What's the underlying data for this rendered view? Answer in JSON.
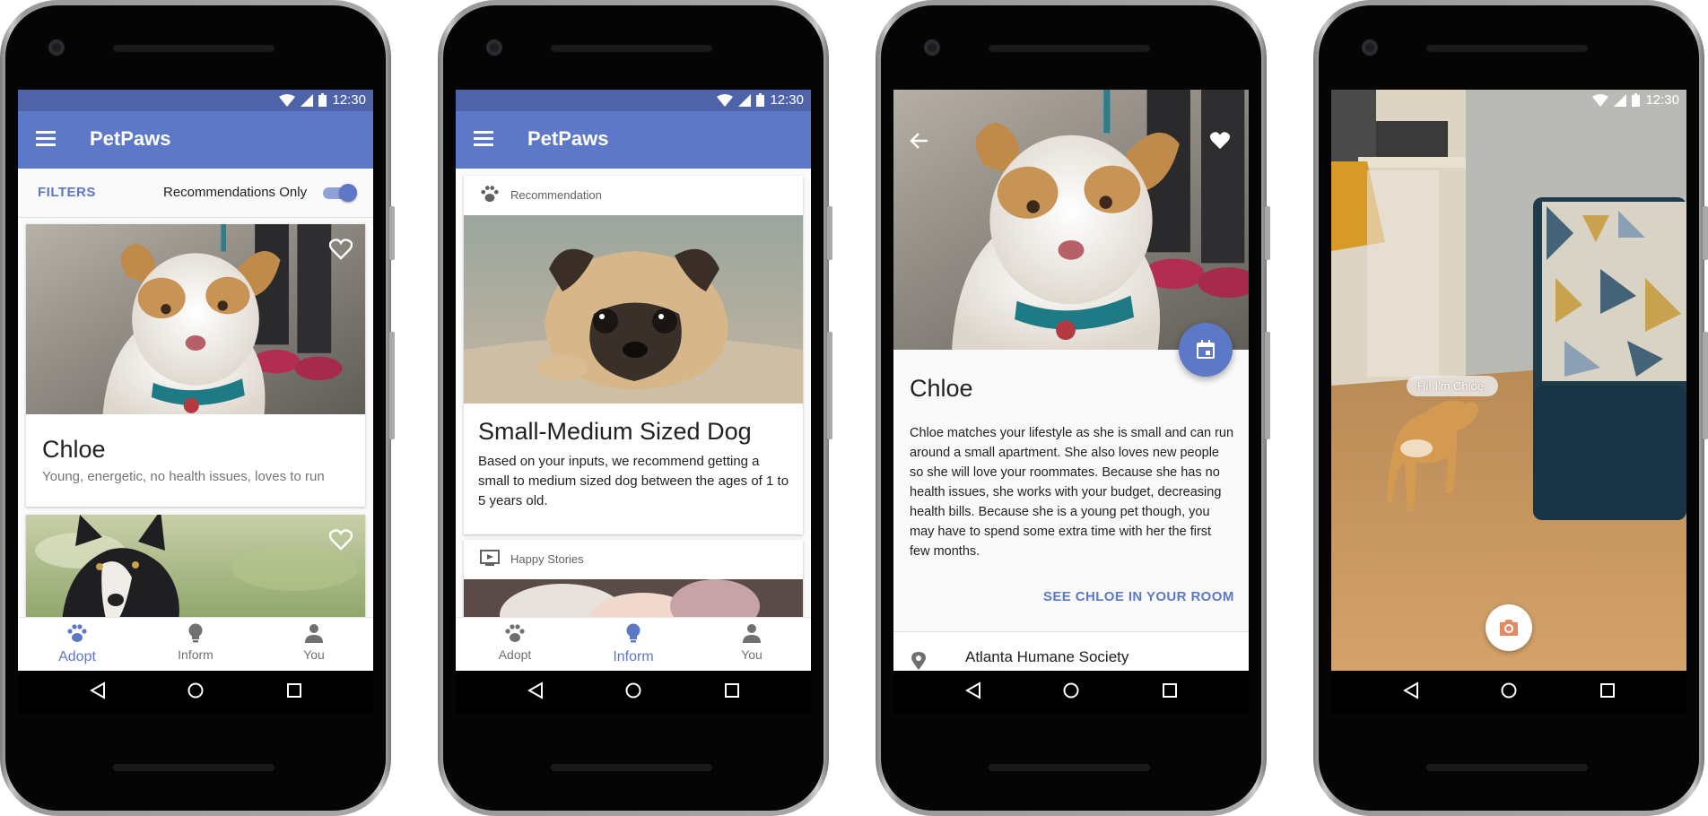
{
  "status": {
    "time": "12:30"
  },
  "app": {
    "title": "PetPaws"
  },
  "screen1": {
    "filters_label": "FILTERS",
    "recommendations_label": "Recommendations Only",
    "recommendations_on": true,
    "cards": [
      {
        "name": "Chloe",
        "description": "Young, energetic, no health issues, loves to run",
        "favorited": false
      },
      {
        "name": "",
        "description": "",
        "favorited": false
      }
    ]
  },
  "screen2": {
    "recommendation_header": "Recommendation",
    "title": "Small-Medium Sized Dog",
    "body": "Based on your inputs, we recommend getting a small to medium sized dog between the ages of 1 to 5 years old.",
    "stories_header": "Happy Stories"
  },
  "screen3": {
    "name": "Chloe",
    "description": "Chloe matches your lifestyle as she is small and can run around a small apartment. She also loves new people so she will love your roommates. Because she has no health issues, she works with your budget, decreasing health bills. Because she is a young pet though, you may have to spend some extra time with her the first few months.",
    "ar_button": "SEE CHLOE IN YOUR ROOM",
    "location": "Atlanta Humane Society",
    "favorited": true
  },
  "screen4": {
    "bubble": "Hi! I'm Chloe."
  },
  "nav": {
    "adopt": "Adopt",
    "inform": "Inform",
    "you": "You"
  },
  "colors": {
    "primary": "#5c78c6",
    "status_bar": "#4f64a8",
    "background": "#fafafa"
  },
  "icons": [
    "menu-icon",
    "heart-icon",
    "paw-icon",
    "bulb-icon",
    "person-icon",
    "back-icon",
    "calendar-icon",
    "location-pin-icon",
    "camera-icon",
    "wifi-icon",
    "signal-icon",
    "battery-icon",
    "slideshow-icon"
  ]
}
